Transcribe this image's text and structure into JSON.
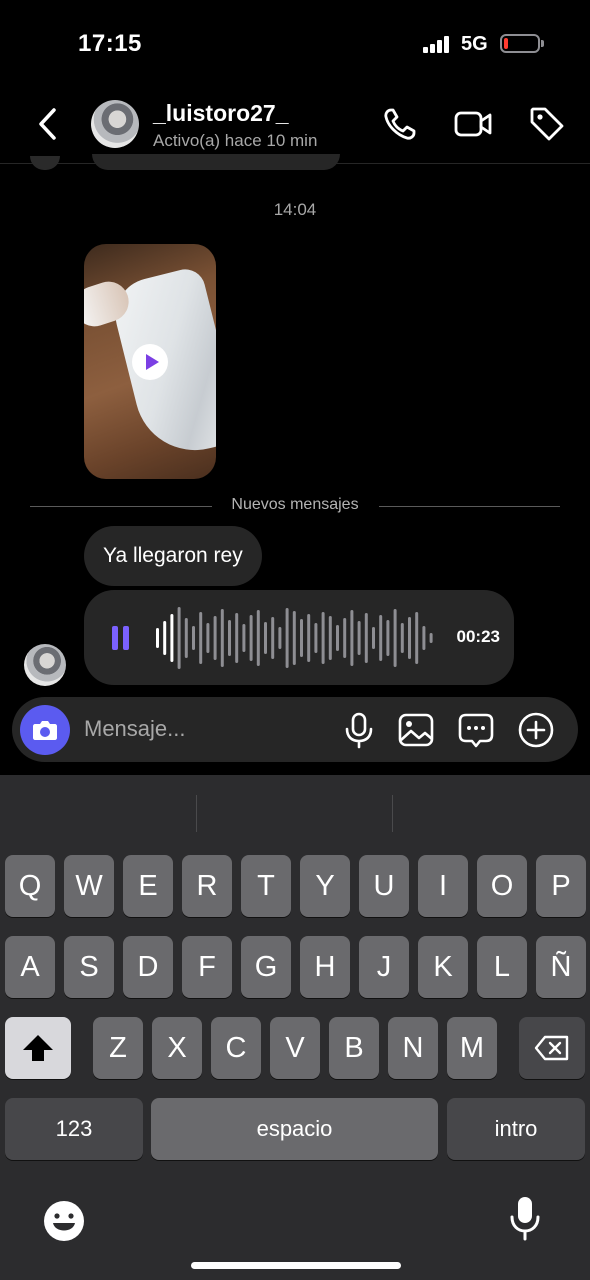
{
  "status_bar": {
    "time": "17:15",
    "network": "5G",
    "battery_color": "#ff3b30"
  },
  "header": {
    "username": "_luistoro27_",
    "activity": "Activo(a) hace 10 min",
    "icons": [
      "chevron-left-icon",
      "phone-icon",
      "video-call-icon",
      "tag-icon"
    ]
  },
  "chat": {
    "timestamp": "14:04",
    "video_message": {
      "has_play": true,
      "accent": "#7b3fe4"
    },
    "divider_label": "Nuevos mensajes",
    "messages": [
      {
        "type": "text",
        "text": "Ya llegaron rey"
      },
      {
        "type": "voice",
        "duration": "00:23",
        "accent": "#7b61ff"
      }
    ]
  },
  "composer": {
    "placeholder": "Mensaje...",
    "camera_color": "#5b5bf0",
    "icons": [
      "camera-icon",
      "microphone-icon",
      "gallery-icon",
      "sticker-icon",
      "plus-icon"
    ]
  },
  "keyboard": {
    "rows": [
      [
        "Q",
        "W",
        "E",
        "R",
        "T",
        "Y",
        "U",
        "I",
        "O",
        "P"
      ],
      [
        "A",
        "S",
        "D",
        "F",
        "G",
        "H",
        "J",
        "K",
        "L",
        "Ñ"
      ],
      [
        "Z",
        "X",
        "C",
        "V",
        "B",
        "N",
        "M"
      ]
    ],
    "numbers_label": "123",
    "space_label": "espacio",
    "return_label": "intro"
  }
}
